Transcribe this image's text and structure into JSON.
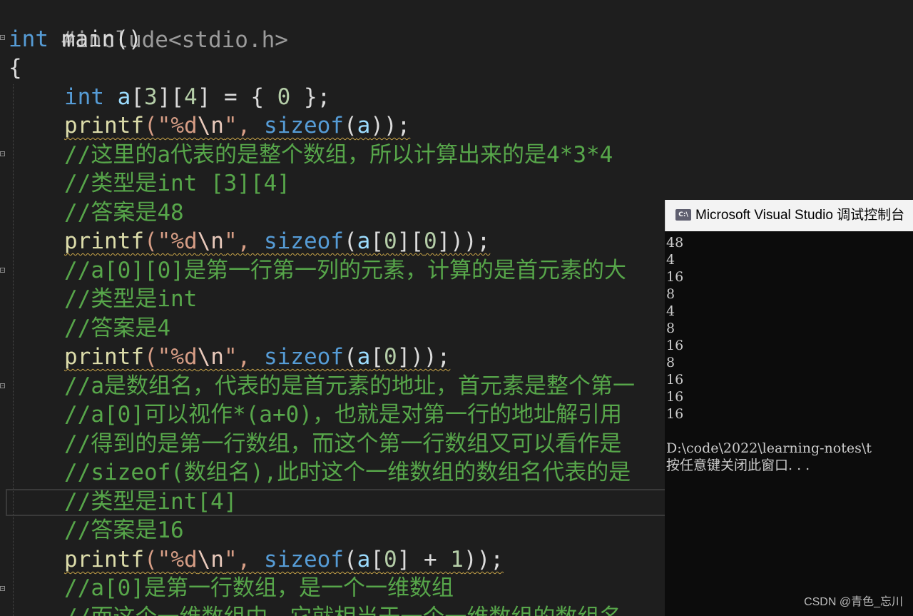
{
  "editor": {
    "lines": {
      "l1": [
        "#include<stdio.h>"
      ],
      "l2": [
        "int",
        " main()"
      ],
      "l3": [
        "{"
      ],
      "l4": [
        "int",
        " ",
        "a",
        "[",
        "3",
        "][",
        "4",
        "] = { ",
        "0",
        " };"
      ],
      "l5": [
        "printf",
        "(\"",
        "%d",
        "\\n",
        "\", ",
        "sizeof",
        "(",
        "a",
        "));"
      ],
      "l6": [
        "//这里的a代表的是整个数组，所以计算出来的是4*3*4"
      ],
      "l7": [
        "//类型是int [3][4]"
      ],
      "l8": [
        "//答案是48"
      ],
      "l9": [
        "printf",
        "(\"",
        "%d",
        "\\n",
        "\", ",
        "sizeof",
        "(",
        "a",
        "[",
        "0",
        "][",
        "0",
        "]));"
      ],
      "l10": [
        "//a[0][0]是第一行第一列的元素，计算的是首元素的大"
      ],
      "l11": [
        "//类型是int"
      ],
      "l12": [
        "//答案是4"
      ],
      "l13": [
        "printf",
        "(\"",
        "%d",
        "\\n",
        "\", ",
        "sizeof",
        "(",
        "a",
        "[",
        "0",
        "]));"
      ],
      "l14": [
        "//a是数组名，代表的是首元素的地址，首元素是整个第一"
      ],
      "l15": [
        "//a[0]可以视作*(a+0)，也就是对第一行的地址解引用"
      ],
      "l16": [
        "//得到的是第一行数组，而这个第一行数组又可以看作是"
      ],
      "l17": [
        "//sizeof(数组名),此时这个一维数组的数组名代表的是"
      ],
      "l18": [
        "//类型是int[4]"
      ],
      "l19": [
        "//答案是16"
      ],
      "l20": [
        "printf",
        "(\"",
        "%d",
        "\\n",
        "\", ",
        "sizeof",
        "(",
        "a",
        "[",
        "0",
        "] + ",
        "1",
        "));"
      ],
      "l21": [
        "//a[0]是第一行数组，是一个一维数组"
      ],
      "l22": [
        "//而这个一维数组中，它就相当于一个一维数组的数组名"
      ]
    }
  },
  "console": {
    "title": "Microsoft Visual Studio 调试控制台",
    "icon": "vs-console-icon",
    "icon_text": "C:\\",
    "output": [
      "48",
      "4",
      "16",
      "8",
      "4",
      "8",
      "16",
      "8",
      "16",
      "16",
      "16",
      "",
      "D:\\code\\2022\\learning-notes\\t",
      "按任意键关闭此窗口. . ."
    ]
  },
  "watermark": "CSDN @青色_忘川",
  "colors": {
    "background": "#1e1e1e",
    "keyword": "#569cd6",
    "function": "#dcdcaa",
    "string": "#d69d85",
    "comment": "#57a64a",
    "number": "#b5cea8",
    "identifier": "#9cdcfe"
  }
}
